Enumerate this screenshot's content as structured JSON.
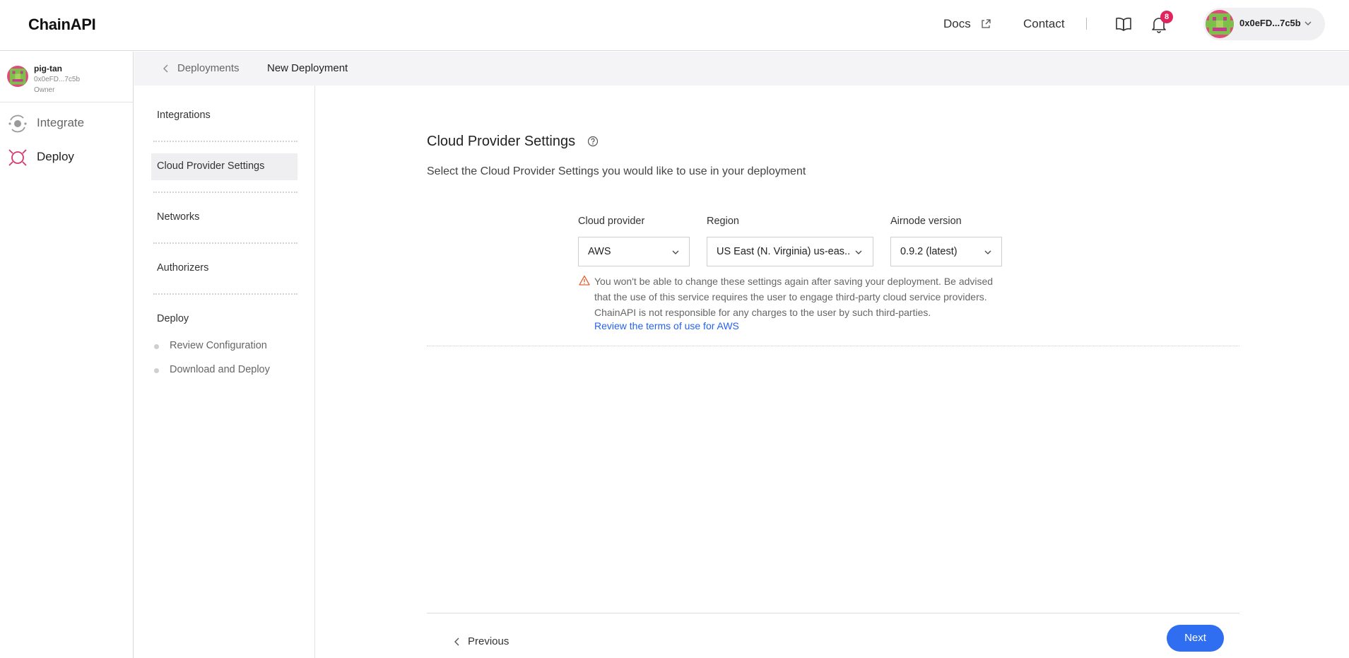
{
  "header": {
    "logo": "ChainAPI",
    "docs_label": "Docs",
    "contact_label": "Contact",
    "notification_count": "8",
    "account_address": "0x0eFD...7c5b"
  },
  "user_sidebar": {
    "name": "pig-tan",
    "address": "0x0eFD...7c5b",
    "role": "Owner",
    "nav": [
      {
        "label": "Integrate",
        "icon": "integrate-icon"
      },
      {
        "label": "Deploy",
        "icon": "deploy-icon"
      }
    ]
  },
  "breadcrumb": {
    "parent": "Deployments",
    "current": "New Deployment"
  },
  "steps": {
    "items": [
      {
        "label": "Integrations"
      },
      {
        "label": "Cloud Provider Settings",
        "active": true
      },
      {
        "label": "Networks"
      },
      {
        "label": "Authorizers"
      },
      {
        "label": "Deploy"
      }
    ],
    "sub_items": [
      {
        "label": "Review Configuration"
      },
      {
        "label": "Download and Deploy"
      }
    ]
  },
  "main": {
    "title": "Cloud Provider Settings",
    "subtitle": "Select the Cloud Provider Settings you would like to use in your deployment",
    "fields": {
      "cloud_provider": {
        "label": "Cloud provider",
        "value": "AWS"
      },
      "region": {
        "label": "Region",
        "value": "US East (N. Virginia) us-eas..."
      },
      "airnode_version": {
        "label": "Airnode version",
        "value": "0.9.2 (latest)"
      }
    },
    "warning": "You won't be able to change these settings again after saving your deployment. Be advised that the use of this service requires the user to engage third-party cloud service providers. ChainAPI is not responsible for any charges to the user by such third-parties.",
    "warning_link": "Review the terms of use for AWS",
    "previous_label": "Previous",
    "next_label": "Next"
  },
  "colors": {
    "accent": "#2f6ef0",
    "link": "#2563eb",
    "badge": "#e0245e",
    "warning": "#e0663a"
  }
}
